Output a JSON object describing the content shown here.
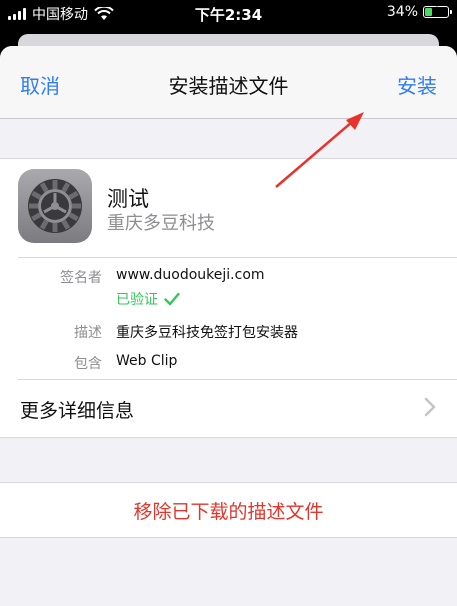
{
  "status_bar": {
    "carrier": "中国移动",
    "time": "下午2:34",
    "battery": "34%",
    "battery_level": 0.34,
    "signal_icon": "signal-bars-icon",
    "wifi_icon": "wifi-icon",
    "battery_icon": "battery-charging-icon"
  },
  "nav": {
    "cancel": "取消",
    "title": "安装描述文件",
    "install": "安装"
  },
  "profile": {
    "icon": "settings-gear-icon",
    "name": "测试",
    "organization": "重庆多豆科技"
  },
  "details": {
    "signer_label": "签名者",
    "signer_value": "www.duodoukeji.com",
    "verified": "已验证",
    "verified_icon": "checkmark-icon",
    "description_label": "描述",
    "description_value": "重庆多豆科技免签打包安装器",
    "contains_label": "包含",
    "contains_value": "Web Clip"
  },
  "more_info": {
    "label": "更多详细信息",
    "icon": "chevron-right-icon"
  },
  "remove": {
    "label": "移除已下载的描述文件"
  },
  "annotation": {
    "icon": "red-arrow-icon",
    "color": "#e8332c"
  },
  "colors": {
    "accent": "#2f7cf6",
    "destructive": "#e0362c",
    "verified": "#34c759"
  }
}
